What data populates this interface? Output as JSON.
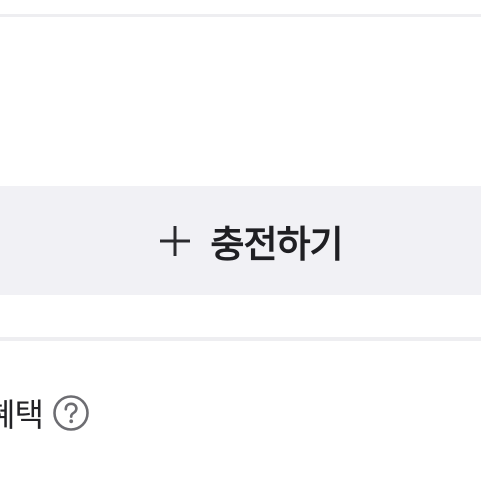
{
  "charge_button": {
    "label": "충전하기",
    "icon": "plus-icon"
  },
  "benefit_section": {
    "label": "혜택",
    "help_icon": "help-icon"
  }
}
